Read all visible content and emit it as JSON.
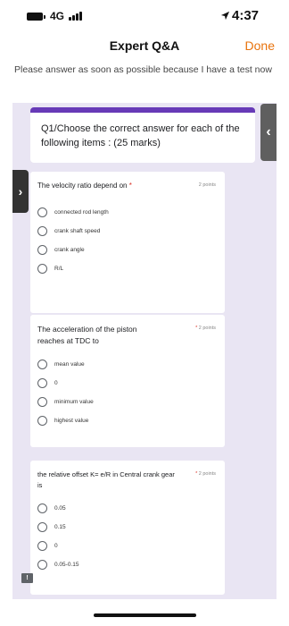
{
  "status_bar": {
    "network": "4G",
    "time": "4:37",
    "icons": [
      "battery-icon",
      "signal-icon",
      "location-arrow-icon"
    ]
  },
  "header": {
    "title": "Expert Q&A",
    "done_label": "Done"
  },
  "question_text": "Please answer as soon as possible because I have a test now",
  "form": {
    "header_title": "Q1/Choose the correct answer for each of the following items : (25 marks)",
    "questions": [
      {
        "title": "The velocity ratio depend on",
        "required_mark": "*",
        "points": "2 points",
        "options": [
          "connected rod length",
          "crank shaft speed",
          "crank angle",
          "R/L"
        ]
      },
      {
        "title": "The acceleration of the piston reaches at TDC to",
        "required_mark": "*",
        "points": "2 points",
        "options": [
          "mean value",
          "0",
          "minimum value",
          "highest value"
        ]
      },
      {
        "title": "the  relative offset K= e/R in Central crank gear is",
        "required_mark": "*",
        "points": "2 points",
        "options": [
          "0.05",
          "0.15",
          "0",
          "0.05-0.15"
        ]
      }
    ]
  },
  "colors": {
    "accent": "#e8730d",
    "form_background": "#e9e5f3",
    "form_accent": "#673ab7"
  }
}
